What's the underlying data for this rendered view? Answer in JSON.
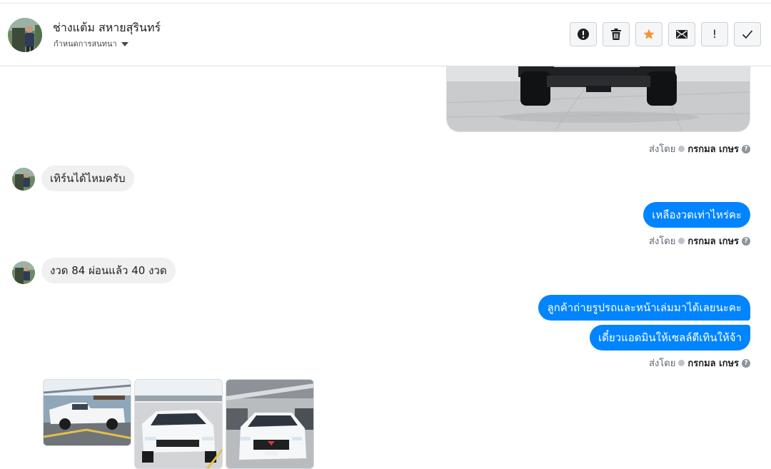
{
  "header": {
    "contact_name": "ช่างแต้ม สหายสุรินทร์",
    "assign_label": "กำหนดการสนทนา",
    "actions": [
      {
        "name": "report-spam",
        "icon": "exclamation-circle-icon"
      },
      {
        "name": "delete",
        "icon": "trash-icon"
      },
      {
        "name": "star",
        "icon": "star-icon"
      },
      {
        "name": "mark-unread",
        "icon": "envelope-icon"
      },
      {
        "name": "flag-important",
        "icon": "exclamation-icon"
      },
      {
        "name": "mark-done",
        "icon": "checkmark-icon"
      }
    ],
    "star_color": "#f7923a"
  },
  "conversation": {
    "sent_by_label": "ส่งโดย",
    "agent_name": "กรกมล เกษร",
    "help_glyph": "?",
    "messages": [
      {
        "dir": "in",
        "text": "เทิร์นได้ไหมครับ"
      },
      {
        "dir": "out",
        "text": "เหลืองวดเท่าไหร่คะ"
      },
      {
        "dir": "in",
        "text": "งวด 84 ผ่อนแล้ว 40 งวด"
      },
      {
        "dir": "out",
        "text": "ลูกค้าถ่ายรูปรถและหน้าเล่มมาได้เลยนะคะ"
      },
      {
        "dir": "out",
        "text": "เดี๋ยวแอดมินให้เซลล์ตีเทินให้จ้า"
      }
    ],
    "attachments": [
      "white-pickup-side-photo",
      "white-pickup-front-photo",
      "white-pickup-front-close-photo"
    ]
  },
  "colors": {
    "outgoing_bubble": "#0084ff",
    "incoming_bubble": "#f0f0f0"
  }
}
